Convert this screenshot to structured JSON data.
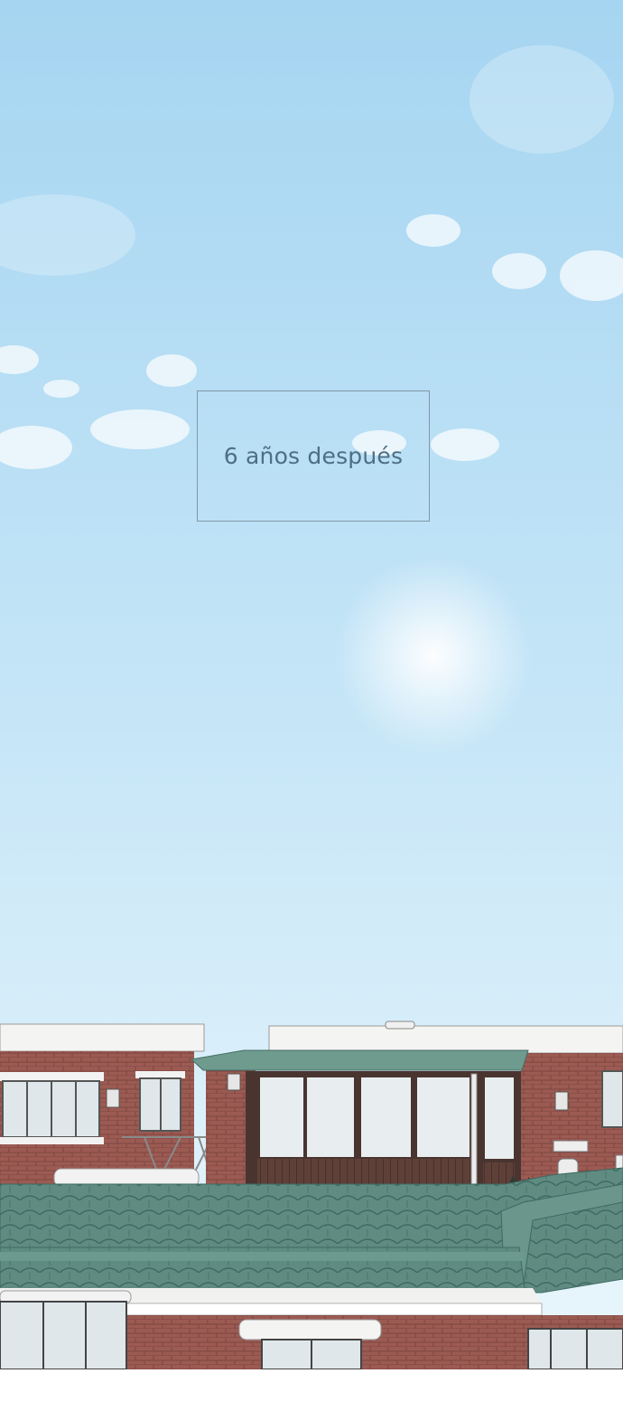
{
  "caption": {
    "text": "6 años después"
  },
  "colors": {
    "sky_top": "#a9d7f2",
    "sky_bottom": "#e6f4fb",
    "brick": "#9a5a52",
    "roof_tile": "#5d8a80",
    "caption_border": "#7f97a6",
    "caption_text": "#4f6f82"
  }
}
